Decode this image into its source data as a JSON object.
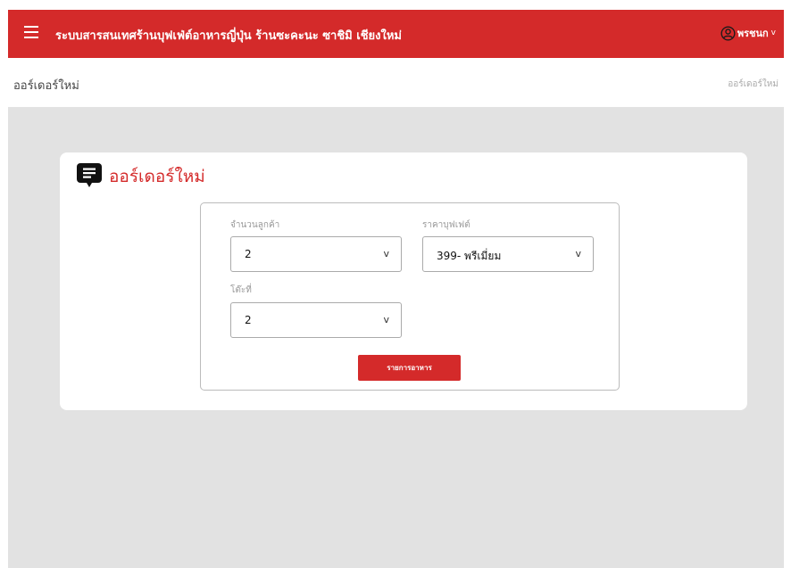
{
  "header": {
    "title": "ระบบสารสนเทศร้านบุฟเฟ่ต์อาหารญี่ปุ่น ร้านซะคะนะ ซาชิมิ เชียงใหม่",
    "user_name": "พรชนก",
    "user_chevron": "v",
    "bg_color": "#d42a2a"
  },
  "subheader": {
    "page_title": "ออร์เดอร์ใหม่",
    "breadcrumb": "ออร์เดอร์ใหม่"
  },
  "card": {
    "title": "ออร์เดอร์ใหม่",
    "icon": "order-note-icon"
  },
  "form": {
    "customers": {
      "label": "จำนวนลูกค้า",
      "value": "2",
      "chevron": "v"
    },
    "buffet_price": {
      "label": "ราคาบุฟเฟต์",
      "value": "399- พรีเมี่ยม",
      "chevron": "v"
    },
    "table": {
      "label": "โต๊ะที่",
      "value": "2",
      "chevron": "v"
    },
    "submit_label": "รายการอาหาร"
  }
}
